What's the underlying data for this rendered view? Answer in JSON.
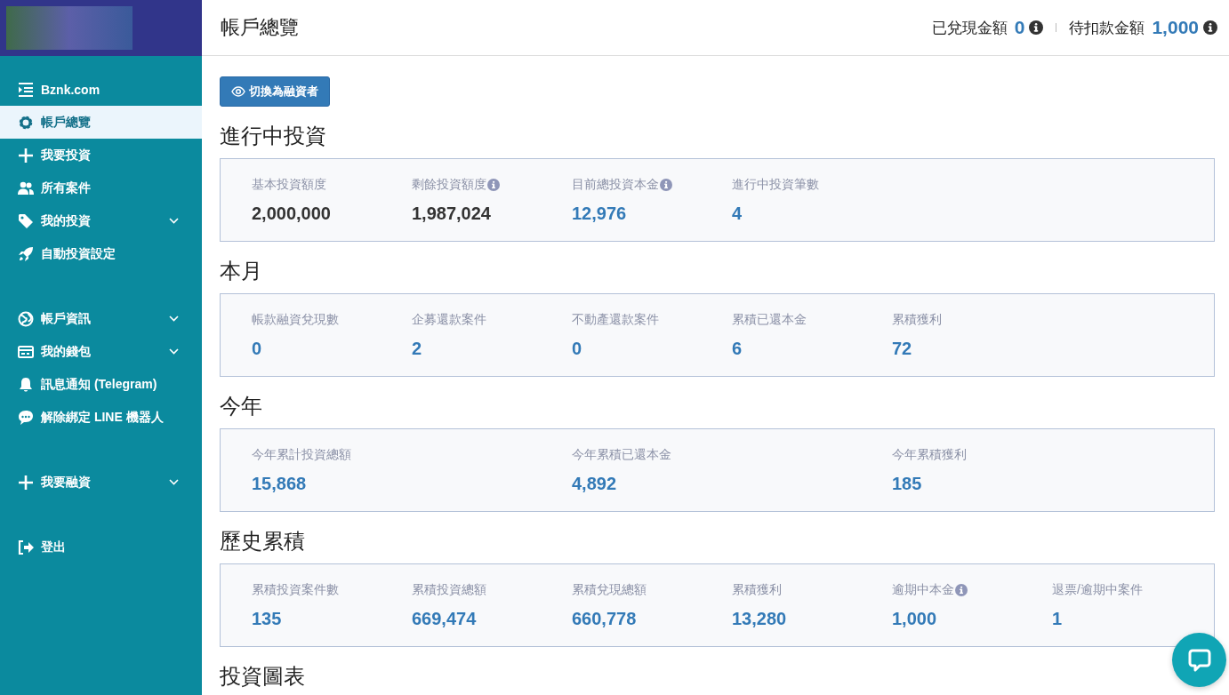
{
  "sidebar": {
    "groups": [
      {
        "items": [
          {
            "label": "Bznk.com",
            "selected": false,
            "expandable": false
          },
          {
            "label": "帳戶總覽",
            "selected": true,
            "expandable": false
          },
          {
            "label": "我要投資",
            "selected": false,
            "expandable": false
          },
          {
            "label": "所有案件",
            "selected": false,
            "expandable": false
          },
          {
            "label": "我的投資",
            "selected": false,
            "expandable": true
          },
          {
            "label": "自動投資設定",
            "selected": false,
            "expandable": false
          }
        ]
      },
      {
        "items": [
          {
            "label": "帳戶資訊",
            "selected": false,
            "expandable": true
          },
          {
            "label": "我的錢包",
            "selected": false,
            "expandable": true
          },
          {
            "label": "訊息通知 (Telegram)",
            "selected": false,
            "expandable": false
          },
          {
            "label": "解除綁定 LINE 機器人",
            "selected": false,
            "expandable": false
          }
        ]
      },
      {
        "items": [
          {
            "label": "我要融資",
            "selected": false,
            "expandable": true
          }
        ]
      },
      {
        "items": [
          {
            "label": "登出",
            "selected": false,
            "expandable": false
          }
        ]
      }
    ]
  },
  "header": {
    "title": "帳戶總覽",
    "balances": [
      {
        "label": "已兌現金額",
        "value": "0",
        "info": true
      },
      {
        "label": "待扣款金額",
        "value": "1,000",
        "info": true
      }
    ]
  },
  "switch_button": {
    "label": "切換為融資者"
  },
  "sections": [
    {
      "title": "進行中投資",
      "kind": "sixths",
      "stats": [
        {
          "label": "基本投資額度",
          "value": "2,000,000",
          "kind": "limit",
          "info": false
        },
        {
          "label": "剩餘投資額度",
          "value": "1,987,024",
          "kind": "limit",
          "info": true
        },
        {
          "label": "目前總投資本金",
          "value": "12,976",
          "kind": "amount",
          "info": true
        },
        {
          "label": "進行中投資筆數",
          "value": "4",
          "kind": "amount",
          "info": false
        }
      ]
    },
    {
      "title": "本月",
      "kind": "sixths",
      "stats": [
        {
          "label": "帳款融資兌現數",
          "value": "0",
          "kind": "amount",
          "info": false
        },
        {
          "label": "企募還款案件",
          "value": "2",
          "kind": "amount",
          "info": false
        },
        {
          "label": "不動產還款案件",
          "value": "0",
          "kind": "amount",
          "info": false
        },
        {
          "label": "累積已還本金",
          "value": "6",
          "kind": "amount",
          "info": false
        },
        {
          "label": "累積獲利",
          "value": "72",
          "kind": "amount",
          "info": false
        }
      ]
    },
    {
      "title": "今年",
      "kind": "thirds",
      "stats": [
        {
          "label": "今年累計投資總額",
          "value": "15,868",
          "kind": "amount",
          "info": false
        },
        {
          "label": "今年累積已還本金",
          "value": "4,892",
          "kind": "amount",
          "info": false
        },
        {
          "label": "今年累積獲利",
          "value": "185",
          "kind": "amount",
          "info": false
        }
      ]
    },
    {
      "title": "歷史累積",
      "kind": "sixths",
      "stats": [
        {
          "label": "累積投資案件數",
          "value": "135",
          "kind": "amount",
          "info": false
        },
        {
          "label": "累積投資總額",
          "value": "669,474",
          "kind": "amount",
          "info": false
        },
        {
          "label": "累積兌現總額",
          "value": "660,778",
          "kind": "amount",
          "info": false
        },
        {
          "label": "累積獲利",
          "value": "13,280",
          "kind": "amount",
          "info": false
        },
        {
          "label": "逾期中本金",
          "value": "1,000",
          "kind": "amount",
          "info": true
        },
        {
          "label": "退票/逾期中案件",
          "value": "1",
          "kind": "amount",
          "info": false
        }
      ]
    },
    {
      "title": "投資圖表",
      "kind": "sixths"
    }
  ]
}
